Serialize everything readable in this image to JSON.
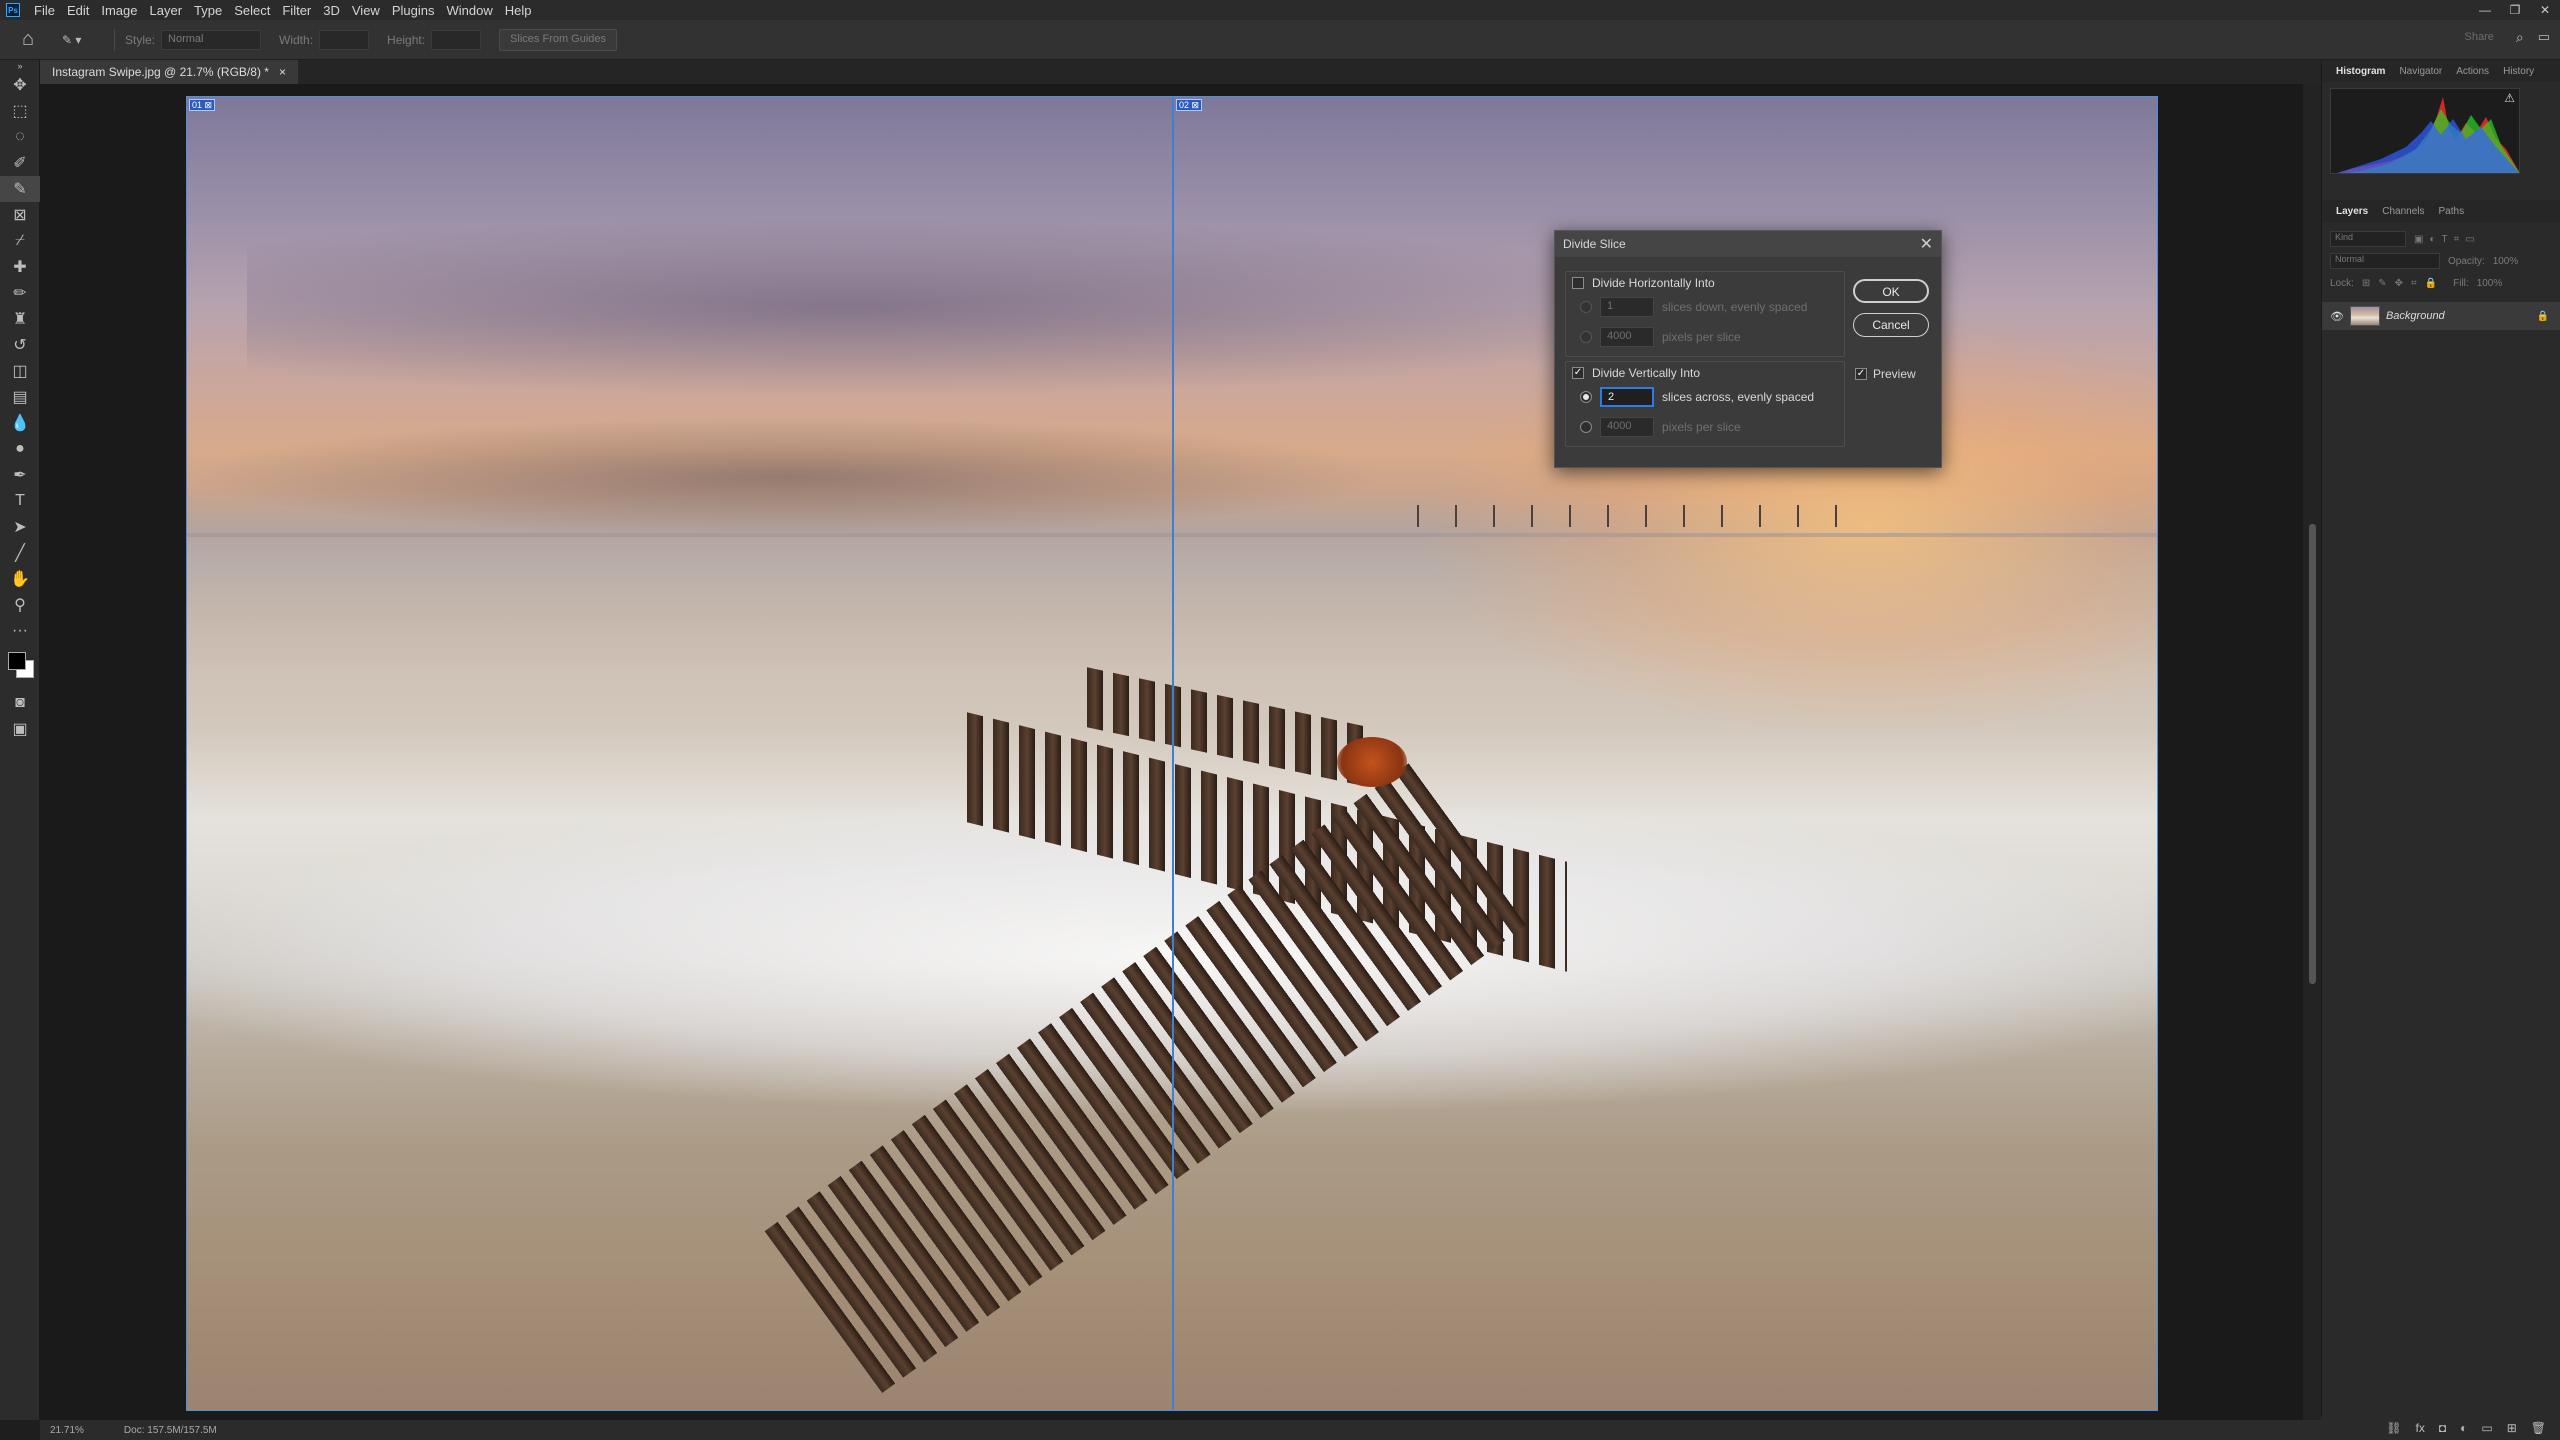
{
  "menubar": {
    "logo": "Ps",
    "items": [
      "File",
      "Edit",
      "Image",
      "Layer",
      "Type",
      "Select",
      "Filter",
      "3D",
      "View",
      "Plugins",
      "Window",
      "Help"
    ],
    "window_controls": [
      "—",
      "❐",
      "✕"
    ]
  },
  "options": {
    "style_label": "Style:",
    "style_value": "Normal",
    "width_label": "Width:",
    "height_label": "Height:",
    "slices_button": "Slices From Guides",
    "share_label": "Share"
  },
  "document": {
    "tab_title": "Instagram Swipe.jpg @ 21.7% (RGB/8) *",
    "tab_close": "×",
    "slice_tags": [
      "01 ⊠",
      "02 ⊠"
    ]
  },
  "statusbar": {
    "zoom": "21.71%",
    "doc_info": "Doc: 157.5M/157.5M"
  },
  "panels": {
    "top_tabs": [
      "Histogram",
      "Navigator",
      "Actions",
      "History"
    ],
    "layer_tabs": [
      "Layers",
      "Channels",
      "Paths"
    ],
    "kind_label": "Kind",
    "blend_mode": "Normal",
    "opacity_label": "Opacity:",
    "opacity_value": "100%",
    "lock_label": "Lock:",
    "fill_label": "Fill:",
    "fill_value": "100%",
    "layer_name": "Background"
  },
  "dialog": {
    "title": "Divide Slice",
    "horizontal_label": "Divide Horizontally Into",
    "h_slices_value": "1",
    "h_slices_label": "slices down, evenly spaced",
    "h_pixels_value": "4000",
    "h_pixels_label": "pixels per slice",
    "vertical_label": "Divide Vertically Into",
    "v_slices_value": "2",
    "v_slices_label": "slices across, evenly spaced",
    "v_pixels_value": "4000",
    "v_pixels_label": "pixels per slice",
    "ok_label": "OK",
    "cancel_label": "Cancel",
    "preview_label": "Preview",
    "horizontal_checked": false,
    "vertical_checked": true,
    "preview_checked": true
  },
  "colors": {
    "accent": "#2f7ae5",
    "guide": "#3d7fd0"
  }
}
